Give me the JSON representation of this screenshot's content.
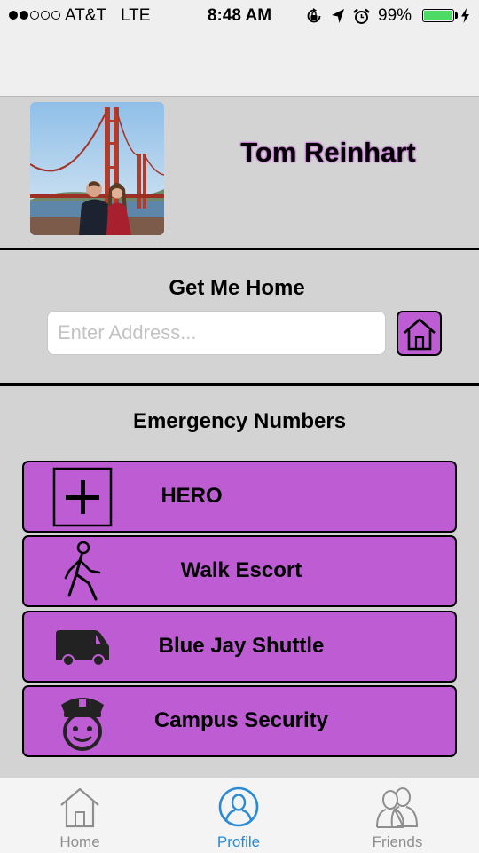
{
  "status_bar": {
    "carrier": "AT&T",
    "network": "LTE",
    "time": "8:48 AM",
    "battery_percent": "99%",
    "signal_bars": 2,
    "battery_level": 0.99,
    "icons": [
      "orientation-lock-icon",
      "location-arrow-icon",
      "alarm-clock-icon",
      "battery-icon",
      "charging-bolt-icon"
    ]
  },
  "profile": {
    "name": "Tom Reinhart",
    "photo": "profile-photo"
  },
  "get_me_home": {
    "title": "Get Me Home",
    "address_placeholder": "Enter Address...",
    "address_value": "",
    "go_icon": "home-icon"
  },
  "emergency": {
    "title": "Emergency Numbers",
    "buttons": [
      {
        "label": "HERO",
        "icon": "medical-cross-icon"
      },
      {
        "label": "Walk Escort",
        "icon": "walking-person-icon"
      },
      {
        "label": "Blue Jay Shuttle",
        "icon": "van-icon"
      },
      {
        "label": "Campus Security",
        "icon": "police-officer-icon"
      }
    ]
  },
  "tabbar": {
    "active": "Profile",
    "tabs": [
      {
        "label": "Home",
        "icon": "house-icon"
      },
      {
        "label": "Profile",
        "icon": "profile-icon"
      },
      {
        "label": "Friends",
        "icon": "friends-icon"
      }
    ]
  },
  "colors": {
    "accent_purple": "#be5cd4",
    "background": "#d3d3d3",
    "tab_active": "#2a8ad6",
    "tab_inactive": "#8e8e8e",
    "battery_green": "#4cd964"
  }
}
